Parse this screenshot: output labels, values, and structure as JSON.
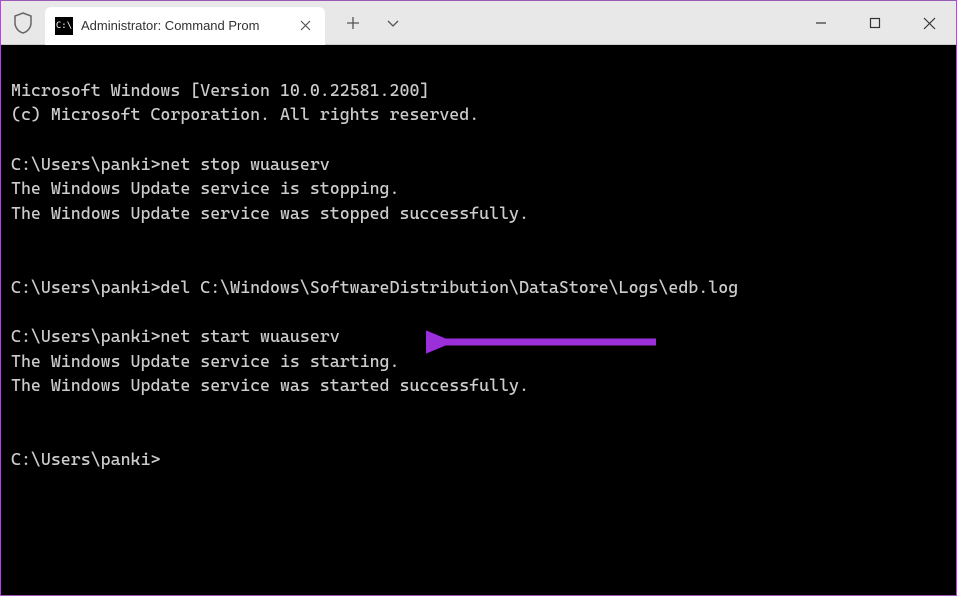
{
  "window": {
    "tab_title": "Administrator: Command Prom",
    "new_tab_tooltip": "New tab",
    "dropdown_tooltip": "Dropdown"
  },
  "terminal": {
    "line1": "Microsoft Windows [Version 10.0.22581.200]",
    "line2": "(c) Microsoft Corporation. All rights reserved.",
    "blank1": "",
    "prompt1": "C:\\Users\\panki>net stop wuauserv",
    "resp1a": "The Windows Update service is stopping.",
    "resp1b": "The Windows Update service was stopped successfully.",
    "blank2": "",
    "blank3": "",
    "prompt2": "C:\\Users\\panki>del C:\\Windows\\SoftwareDistribution\\DataStore\\Logs\\edb.log",
    "blank4": "",
    "prompt3": "C:\\Users\\panki>net start wuauserv",
    "resp3a": "The Windows Update service is starting.",
    "resp3b": "The Windows Update service was started successfully.",
    "blank5": "",
    "blank6": "",
    "prompt4": "C:\\Users\\panki>"
  },
  "annotation": {
    "arrow_color": "#9b2fd9"
  }
}
